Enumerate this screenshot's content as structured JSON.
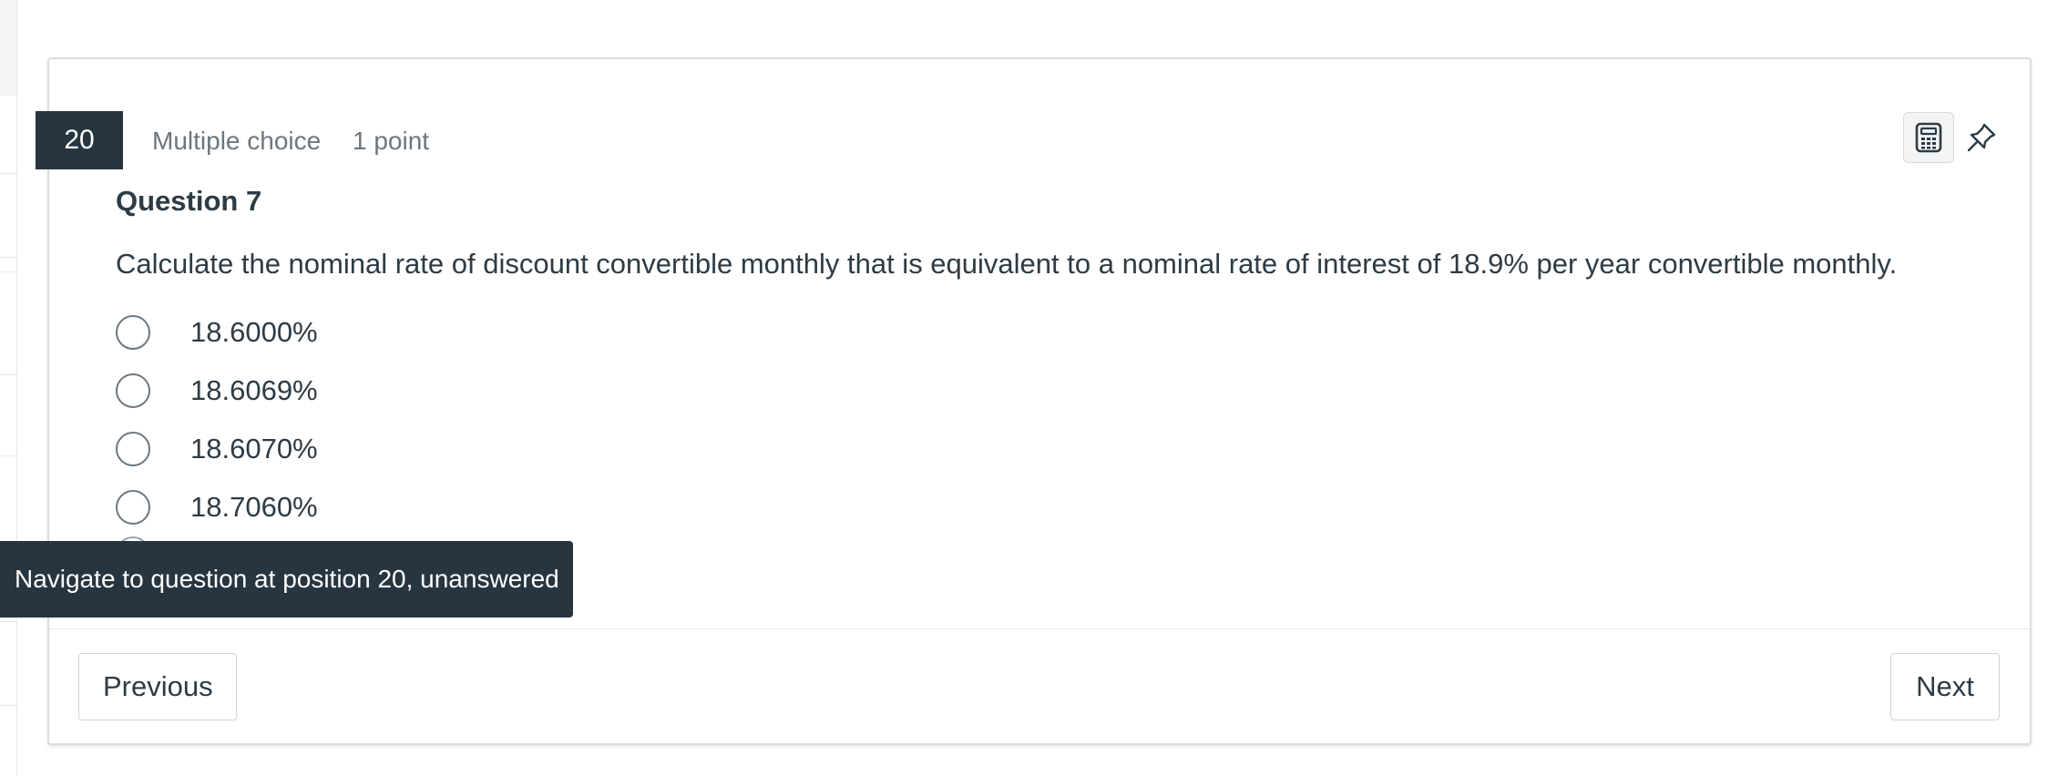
{
  "question_header": {
    "number": "20",
    "type": "Multiple choice",
    "points": "1 point"
  },
  "toolbar": {
    "calculator_icon": "calculator-icon",
    "pin_icon": "pin-icon"
  },
  "question": {
    "title": "Question 7",
    "text": "Calculate the nominal rate of discount convertible monthly that is equivalent to a nominal rate of interest of 18.9% per year convertible monthly.",
    "options": [
      {
        "label": "18.6000%"
      },
      {
        "label": "18.6069%"
      },
      {
        "label": "18.6070%"
      },
      {
        "label": "18.7060%"
      }
    ]
  },
  "tooltip": {
    "text": "Navigate to question at position 20, unanswered"
  },
  "navigation": {
    "previous_label": "Previous",
    "next_label": "Next"
  },
  "colors": {
    "number_badge_bg": "#273540",
    "tooltip_bg": "#273540",
    "text_primary": "#2d3b45",
    "text_muted": "#6b7780",
    "border": "#dadddf"
  }
}
